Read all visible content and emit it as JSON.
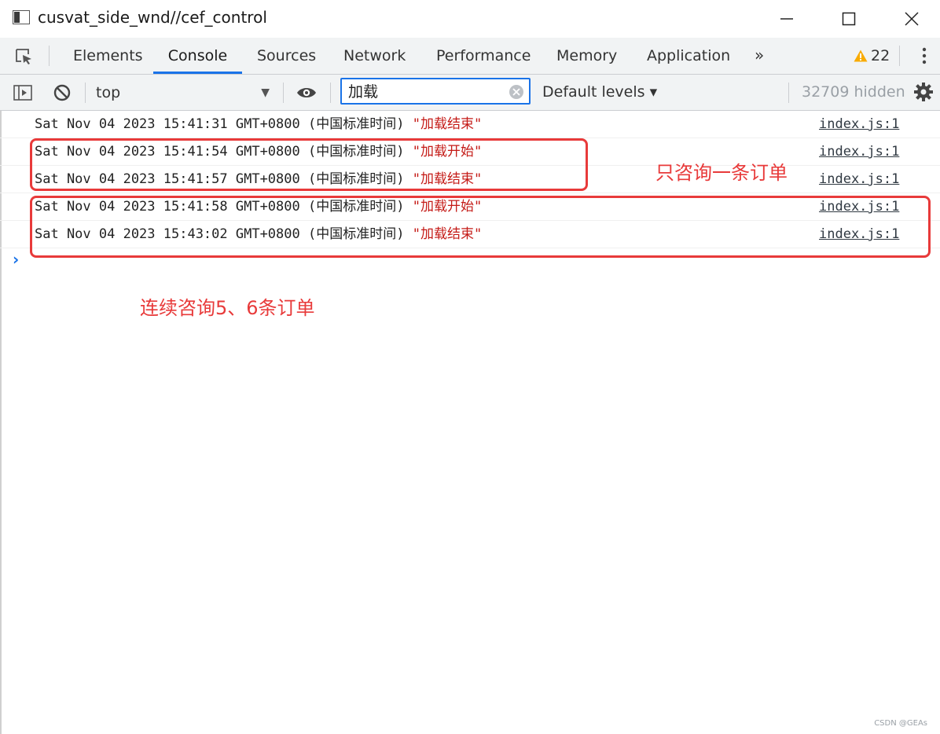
{
  "window": {
    "title": "cusvat_side_wnd//cef_control",
    "controls": {
      "minimize": "—",
      "maximize": "☐",
      "close": "✕"
    }
  },
  "tabs": [
    {
      "label": "Elements",
      "active": false
    },
    {
      "label": "Console",
      "active": true
    },
    {
      "label": "Sources",
      "active": false
    },
    {
      "label": "Network",
      "active": false
    },
    {
      "label": "Performance",
      "active": false
    },
    {
      "label": "Memory",
      "active": false
    },
    {
      "label": "Application",
      "active": false
    }
  ],
  "tab_more": "»",
  "warnings": {
    "count": "22",
    "icon": "warning-triangle-icon"
  },
  "toolbar": {
    "context": "top",
    "filter_value": "加载",
    "levels": "Default levels ▾",
    "hidden": "32709 hidden"
  },
  "messages": [
    {
      "date": "Sat Nov 04 2023 15:41:31 GMT+0800 (中国标准时间) ",
      "str": "\"加载结束\"",
      "link": "index.js:1"
    },
    {
      "date": "Sat Nov 04 2023 15:41:54 GMT+0800 (中国标准时间) ",
      "str": "\"加载开始\"",
      "link": "index.js:1"
    },
    {
      "date": "Sat Nov 04 2023 15:41:57 GMT+0800 (中国标准时间) ",
      "str": "\"加载结束\"",
      "link": "index.js:1"
    },
    {
      "date": "Sat Nov 04 2023 15:41:58 GMT+0800 (中国标准时间) ",
      "str": "\"加载开始\"",
      "link": "index.js:1"
    },
    {
      "date": "Sat Nov 04 2023 15:43:02 GMT+0800 (中国标准时间) ",
      "str": "\"加载结束\"",
      "link": "index.js:1"
    }
  ],
  "prompt": "›",
  "annotations": {
    "single": "只咨询一条订单",
    "multiple": "连续咨询5、6条订单",
    "color": "#e83a3a"
  },
  "watermark": "CSDN @GEAs",
  "colors": {
    "accent": "#1a73e8",
    "string": "#c41a16",
    "warning": "#f9ab00"
  }
}
